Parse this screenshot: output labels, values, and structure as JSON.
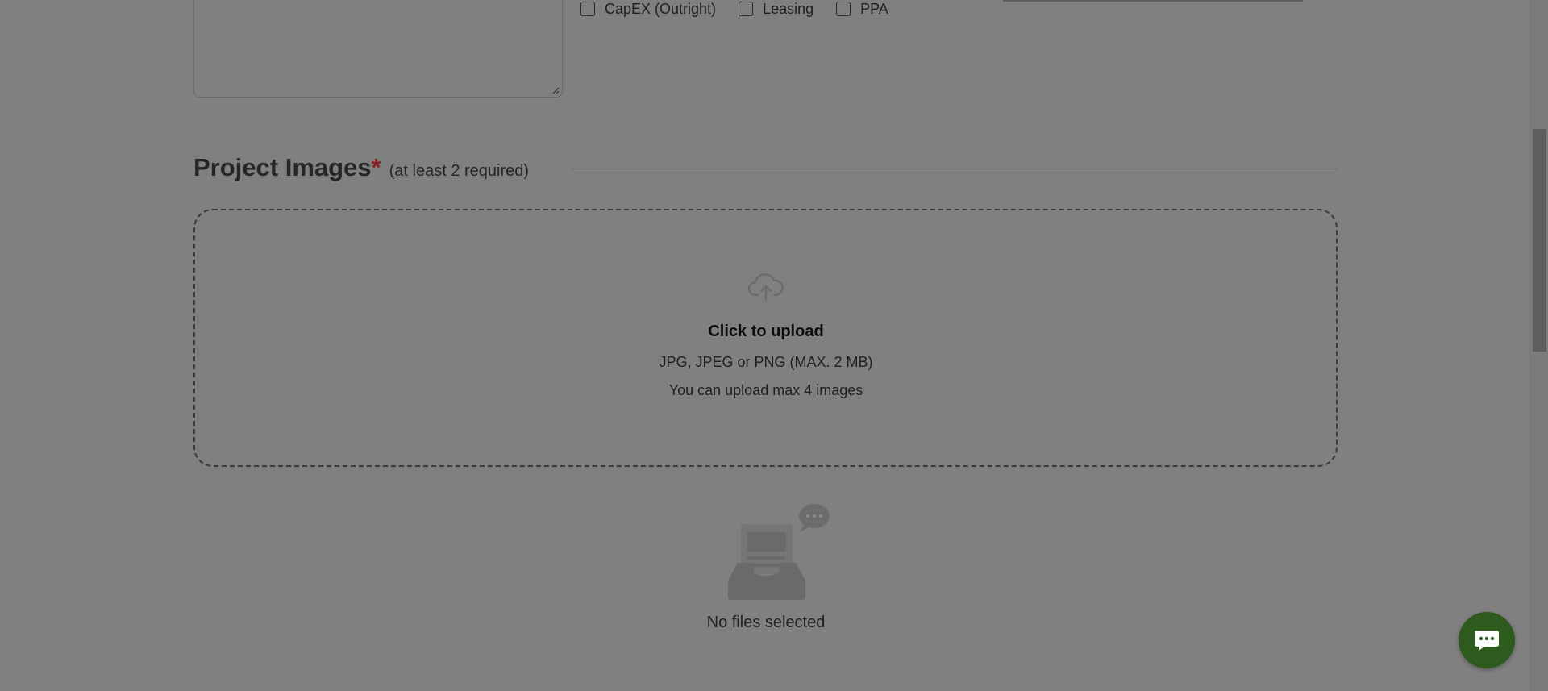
{
  "financing_options": [
    {
      "label": "CapEX (Outright)",
      "checked": false
    },
    {
      "label": "Leasing",
      "checked": false
    },
    {
      "label": "PPA",
      "checked": false
    }
  ],
  "project_images": {
    "title": "Project Images",
    "required_mark": "*",
    "hint": "(at least 2 required)"
  },
  "upload": {
    "icon": "cloud-upload-icon",
    "cta": "Click to upload",
    "formats": "JPG, JPEG or PNG (MAX. 2 MB)",
    "limit": "You can upload max 4 images"
  },
  "empty_state": {
    "icon": "empty-inbox-icon",
    "text": "No files selected"
  },
  "chat": {
    "icon": "chat-bubble-icon",
    "color": "#2f5a1e"
  },
  "colors": {
    "overlay_background": "#808080",
    "required": "#8a2323"
  }
}
